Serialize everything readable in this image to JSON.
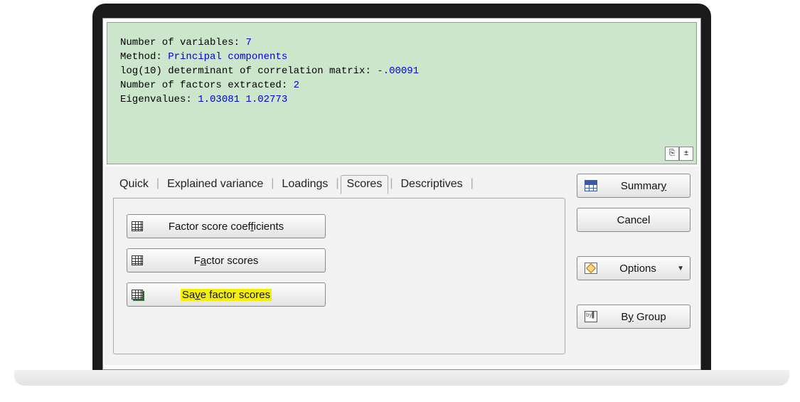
{
  "output": {
    "line1_label": "Number of variables: ",
    "line1_value": "7",
    "line2_label": "Method: ",
    "line2_value": "Principal components",
    "line3_label": "log(10) determinant of correlation matrix: ",
    "line3_value": "-.00091",
    "line4_label": "Number of factors extracted: ",
    "line4_value": "2",
    "line5_label": "Eigenvalues: ",
    "line5_value": "1.03081  1.02773"
  },
  "tabs": {
    "quick": "Quick",
    "explained": "Explained variance",
    "loadings": "Loadings",
    "scores": "Scores",
    "descriptives": "Descriptives"
  },
  "buttons": {
    "factor_score_coefficients": "Factor score coefficients",
    "factor_scores": "Factor scores",
    "save_factor_scores": "Save factor scores"
  },
  "side": {
    "summary": "Summary",
    "cancel": "Cancel",
    "options": "Options",
    "by_group": "By Group",
    "byg_icon_text": "by▌"
  },
  "icons": {
    "copy": "⎘",
    "up": "±"
  }
}
